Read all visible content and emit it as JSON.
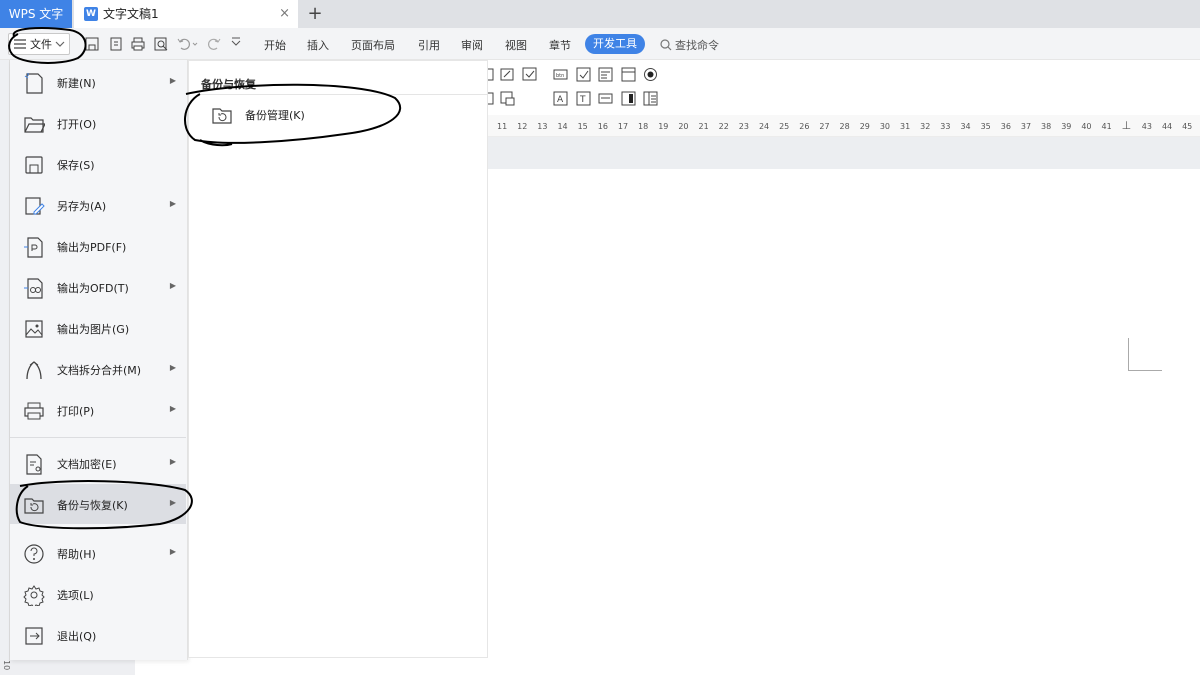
{
  "titlebar": {
    "app_tab": "WPS 文字",
    "doc_tab": "文字文稿1",
    "doc_close": "×",
    "new_tab": "+"
  },
  "toolbar": {
    "file_label": "文件",
    "tabs": [
      "开始",
      "插入",
      "页面布局",
      "引用",
      "审阅",
      "视图",
      "章节"
    ],
    "active_tab": "开发工具",
    "search_label": "查找命令"
  },
  "file_menu": {
    "items": [
      {
        "label": "新建(N)",
        "icon": "new-file-icon",
        "submenu": true
      },
      {
        "label": "打开(O)",
        "icon": "folder-open-icon",
        "submenu": false
      },
      {
        "label": "保存(S)",
        "icon": "save-icon",
        "submenu": false
      },
      {
        "label": "另存为(A)",
        "icon": "save-as-icon",
        "submenu": true
      },
      {
        "label": "输出为PDF(F)",
        "icon": "pdf-export-icon",
        "submenu": false
      },
      {
        "label": "输出为OFD(T)",
        "icon": "ofd-export-icon",
        "submenu": true
      },
      {
        "label": "输出为图片(G)",
        "icon": "image-export-icon",
        "submenu": false
      },
      {
        "label": "文档拆分合并(M)",
        "icon": "split-merge-icon",
        "submenu": true
      },
      {
        "label": "打印(P)",
        "icon": "print-icon",
        "submenu": true
      },
      {
        "label": "文档加密(E)",
        "icon": "encrypt-icon",
        "submenu": true
      },
      {
        "label": "备份与恢复(K)",
        "icon": "backup-restore-icon",
        "submenu": true,
        "active": true
      },
      {
        "label": "帮助(H)",
        "icon": "help-icon",
        "submenu": true
      },
      {
        "label": "选项(L)",
        "icon": "options-gear-icon",
        "submenu": false
      },
      {
        "label": "退出(Q)",
        "icon": "exit-icon",
        "submenu": false
      }
    ]
  },
  "submenu": {
    "title": "备份与恢复",
    "items": [
      {
        "label": "备份管理(K)",
        "icon": "backup-manage-icon"
      }
    ]
  },
  "ruler": {
    "ticks": [
      "11",
      "12",
      "13",
      "14",
      "15",
      "16",
      "17",
      "18",
      "19",
      "20",
      "21",
      "22",
      "23",
      "24",
      "25",
      "26",
      "27",
      "28",
      "29",
      "30",
      "31",
      "32",
      "33",
      "34",
      "35",
      "36",
      "37",
      "38",
      "39",
      "40",
      "41",
      "",
      "43",
      "44",
      "45"
    ]
  },
  "vertical_ruler_label": "10",
  "colors": {
    "accent": "#3f83e6",
    "menu_bg": "#f5f6f8",
    "active_item_bg": "#dcdee3",
    "annotation": "#000000"
  }
}
